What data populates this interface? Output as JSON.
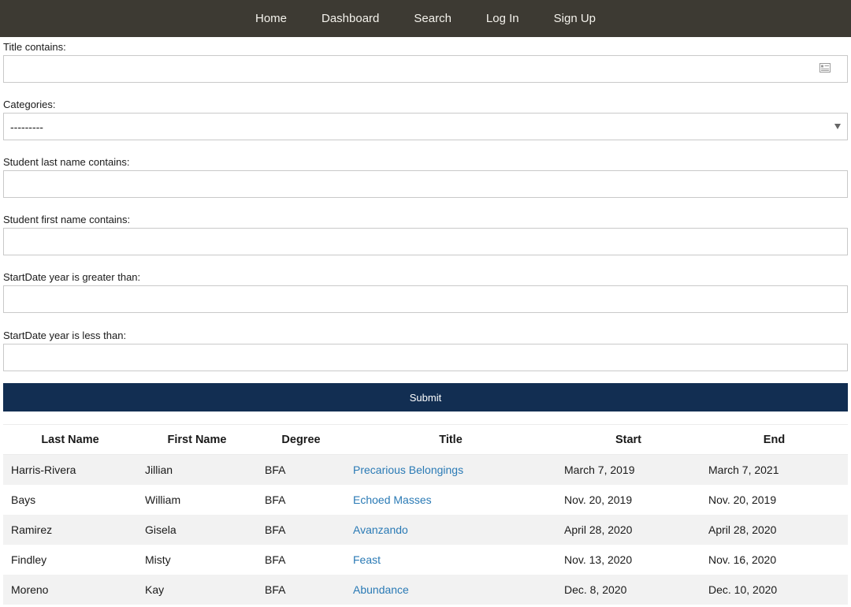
{
  "nav": {
    "items": [
      {
        "label": "Home"
      },
      {
        "label": "Dashboard"
      },
      {
        "label": "Search"
      },
      {
        "label": "Log In"
      },
      {
        "label": "Sign Up"
      }
    ]
  },
  "filters": {
    "title_label": "Title contains:",
    "title_value": "",
    "categories_label": "Categories:",
    "categories_selected": "---------",
    "last_name_label": "Student last name contains:",
    "last_name_value": "",
    "first_name_label": "Student first name contains:",
    "first_name_value": "",
    "start_gt_label": "StartDate year is greater than:",
    "start_gt_value": "",
    "start_lt_label": "StartDate year is less than:",
    "start_lt_value": "",
    "submit_label": "Submit"
  },
  "table": {
    "headers": [
      "Last Name",
      "First Name",
      "Degree",
      "Title",
      "Start",
      "End"
    ],
    "rows": [
      [
        "Harris-Rivera",
        "Jillian",
        "BFA",
        "Precarious Belongings",
        "March 7, 2019",
        "March 7, 2021"
      ],
      [
        "Bays",
        "William",
        "BFA",
        "Echoed Masses",
        "Nov. 20, 2019",
        "Nov. 20, 2019"
      ],
      [
        "Ramirez",
        "Gisela",
        "BFA",
        "Avanzando",
        "April 28, 2020",
        "April 28, 2020"
      ],
      [
        "Findley",
        "Misty",
        "BFA",
        "Feast",
        "Nov. 13, 2020",
        "Nov. 16, 2020"
      ],
      [
        "Moreno",
        "Kay",
        "BFA",
        "Abundance",
        "Dec. 8, 2020",
        "Dec. 10, 2020"
      ]
    ]
  },
  "colors": {
    "nav_bg": "#3d3a33",
    "submit_bg": "#122e52",
    "link": "#2a7ab5",
    "stripe": "#f2f2f2"
  },
  "icons": {
    "title_input_icon": "contact-card-icon",
    "select_icon": "dropdown-arrow-icon"
  }
}
